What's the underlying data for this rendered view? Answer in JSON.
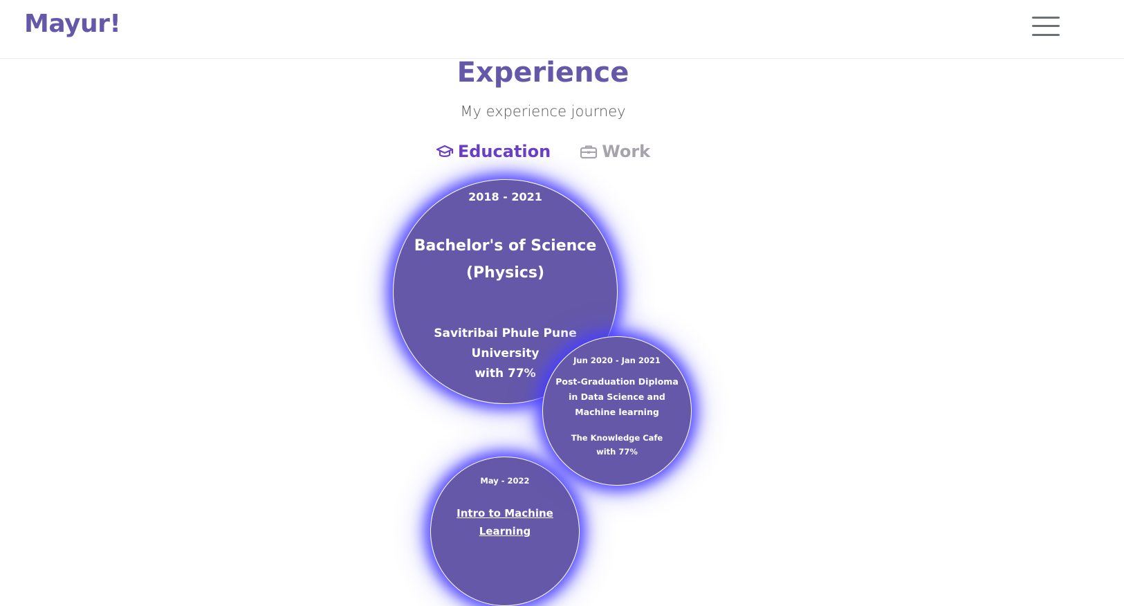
{
  "header": {
    "brand": "Mayur!",
    "menu_icon": "hamburger-menu-icon"
  },
  "section": {
    "title": "Experience",
    "subtitle": "My experience journey"
  },
  "tabs": [
    {
      "label": "Education",
      "icon": "graduation-cap-icon",
      "active": true
    },
    {
      "label": "Work",
      "icon": "briefcase-icon",
      "active": false
    }
  ],
  "timeline": [
    {
      "date": "2018 - 2021",
      "title": "Bachelor's of Science (Physics)",
      "institution": "Savitribai Phule Pune University",
      "score": "with 77%"
    },
    {
      "date": "Jun 2020 - Jan 2021",
      "title": "Post-Graduation Diploma in Data Science and Machine learning",
      "institution": "The Knowledge Cafe",
      "score": "with 77%"
    },
    {
      "date": "May - 2022",
      "title": "Intro to Machine Learning"
    }
  ],
  "colors": {
    "brand": "#6558a8",
    "active_tab": "#6a3fc6",
    "inactive_tab": "#a7a3ad",
    "bubble_glow": "#4a3cff"
  }
}
